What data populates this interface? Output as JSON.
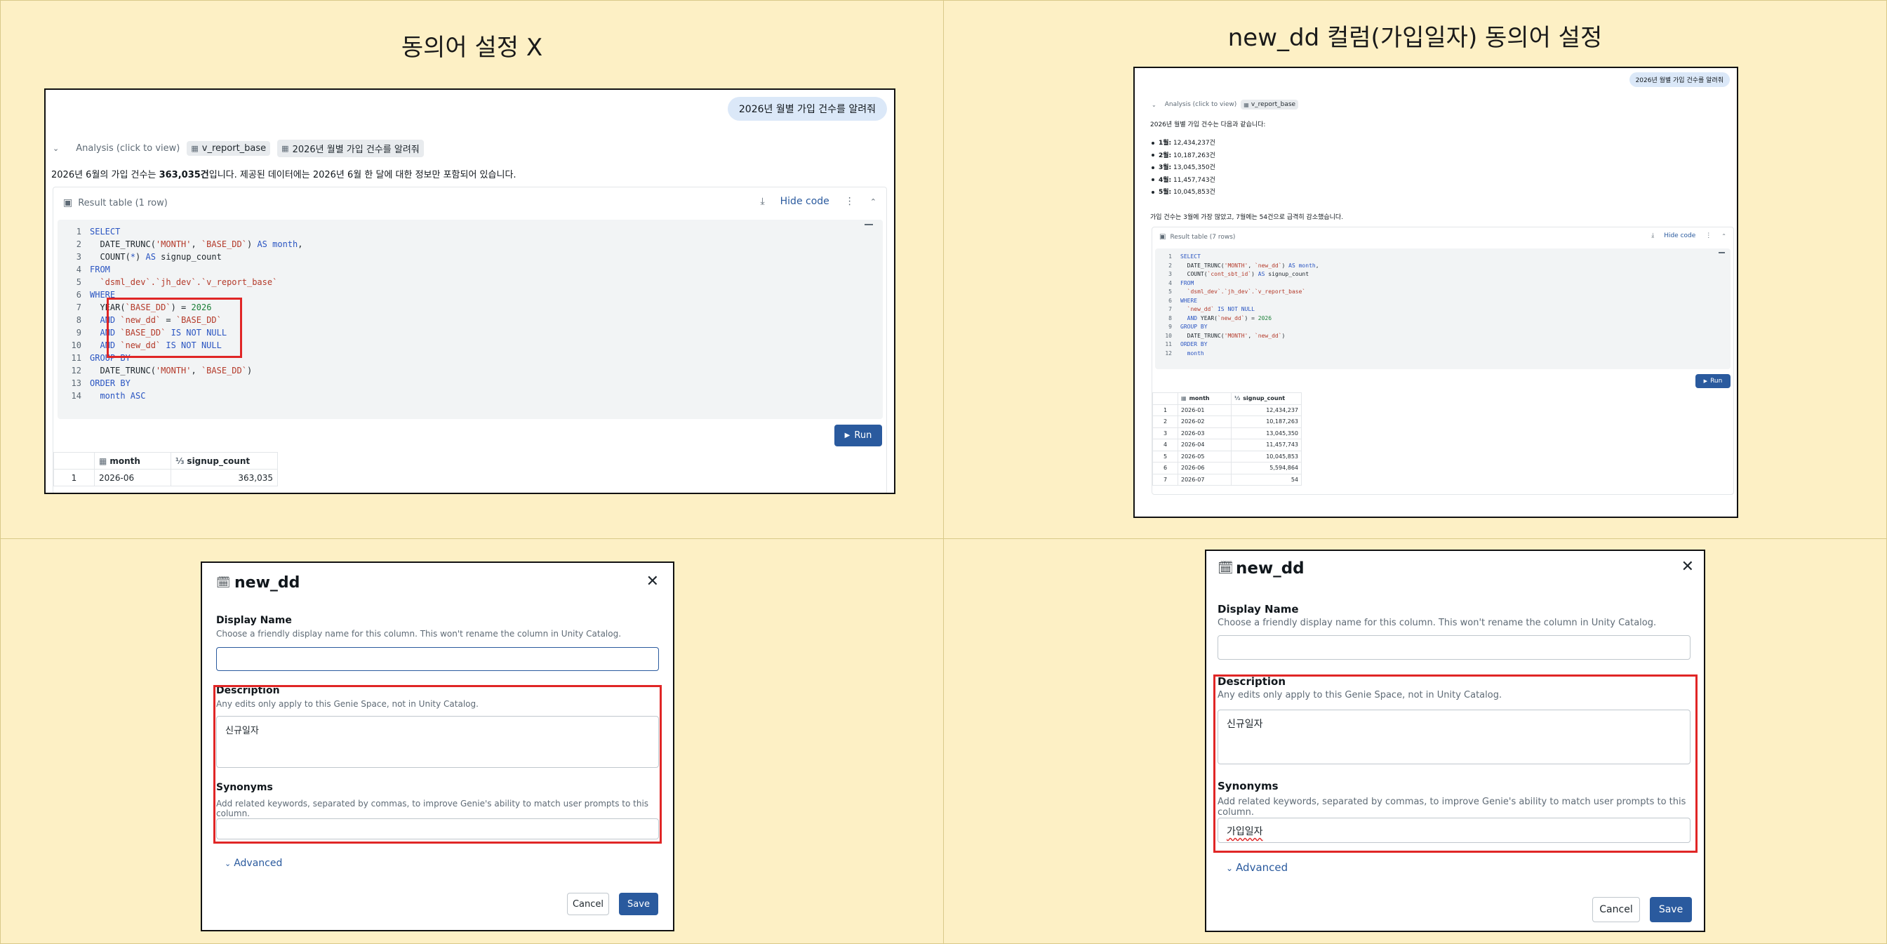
{
  "quadrants": {
    "top_left_title": "동의어 설정 X",
    "top_right_title": "new_dd 컬럼(가입일자) 동의어 설정"
  },
  "left_chat": {
    "user_message": "2026년 월별 가입 건수를 알려줘",
    "analysis_label": "Analysis (click to view)",
    "chip_table": "v_report_base",
    "chip_query": "2026년 월별 가입 건수를 알려줘",
    "answer_pre": "2026년 6월의 가입 건수는 ",
    "answer_bold": "363,035건",
    "answer_post": "입니다. 제공된 데이터에는 2026년 6월 한 달에 대한 정보만 포함되어 있습니다.",
    "result_title": "Result table (1 row)",
    "hide_code": "Hide code",
    "run_label": "Run",
    "code_lines": [
      [
        "1",
        [
          [
            "kw",
            "SELECT"
          ]
        ]
      ],
      [
        "2",
        [
          [
            "plain",
            "  DATE_TRUNC("
          ],
          [
            "str",
            "'MONTH'"
          ],
          [
            "plain",
            ", "
          ],
          [
            "str",
            "`BASE_DD`"
          ],
          [
            "plain",
            ") "
          ],
          [
            "kw",
            "AS"
          ],
          [
            "kw",
            " month"
          ],
          [
            "plain",
            ","
          ]
        ]
      ],
      [
        "3",
        [
          [
            "plain",
            "  COUNT("
          ],
          [
            "kw",
            "*"
          ],
          [
            "plain",
            ") "
          ],
          [
            "kw",
            "AS"
          ],
          [
            "plain",
            " signup_count"
          ]
        ]
      ],
      [
        "4",
        [
          [
            "kw",
            "FROM"
          ]
        ]
      ],
      [
        "5",
        [
          [
            "str",
            "  `dsml_dev`.`jh_dev`.`v_report_base`"
          ]
        ]
      ],
      [
        "6",
        [
          [
            "kw",
            "WHERE"
          ]
        ]
      ],
      [
        "7",
        [
          [
            "plain",
            "  YEAR("
          ],
          [
            "str",
            "`BASE_DD`"
          ],
          [
            "plain",
            ") = "
          ],
          [
            "num",
            "2026"
          ]
        ]
      ],
      [
        "8",
        [
          [
            "kw",
            "  AND "
          ],
          [
            "str",
            "`new_dd`"
          ],
          [
            "plain",
            " = "
          ],
          [
            "str",
            "`BASE_DD`"
          ]
        ]
      ],
      [
        "9",
        [
          [
            "kw",
            "  AND "
          ],
          [
            "str",
            "`BASE_DD`"
          ],
          [
            "kw",
            " IS NOT NULL"
          ]
        ]
      ],
      [
        "10",
        [
          [
            "kw",
            "  AND "
          ],
          [
            "str",
            "`new_dd`"
          ],
          [
            "kw",
            " IS NOT NULL"
          ]
        ]
      ],
      [
        "11",
        [
          [
            "kw",
            "GROUP BY"
          ]
        ]
      ],
      [
        "12",
        [
          [
            "plain",
            "  DATE_TRUNC("
          ],
          [
            "str",
            "'MONTH'"
          ],
          [
            "plain",
            ", "
          ],
          [
            "str",
            "`BASE_DD`"
          ],
          [
            "plain",
            ")"
          ]
        ]
      ],
      [
        "13",
        [
          [
            "kw",
            "ORDER BY"
          ]
        ]
      ],
      [
        "14",
        [
          [
            "kw",
            "  month ASC"
          ]
        ]
      ]
    ],
    "table_headers": [
      "month",
      "signup_count"
    ],
    "table_rows": [
      [
        "1",
        "2026-06",
        "363,035"
      ]
    ]
  },
  "right_chat": {
    "user_message": "2026년 월별 가입 건수를 알려줘",
    "analysis_label": "Analysis (click to view)",
    "chip_table": "v_report_base",
    "answer_intro": "2026년 월별 가입 건수는 다음과 같습니다:",
    "bullets": [
      {
        "month": "1월:",
        "value": "12,434,237건"
      },
      {
        "month": "2월:",
        "value": "10,187,263건"
      },
      {
        "month": "3월:",
        "value": "13,045,350건"
      },
      {
        "month": "4월:",
        "value": "11,457,743건"
      },
      {
        "month": "5월:",
        "value": "10,045,853건"
      }
    ],
    "answer_tail": "가입 건수는 3월에 가장 많았고, 7월에는 54건으로 급격히 감소했습니다.",
    "result_title": "Result table (7 rows)",
    "hide_code": "Hide code",
    "run_label": "Run",
    "code_lines": [
      [
        "1",
        [
          [
            "kw",
            "SELECT"
          ]
        ]
      ],
      [
        "2",
        [
          [
            "plain",
            "  DATE_TRUNC("
          ],
          [
            "str",
            "'MONTH'"
          ],
          [
            "plain",
            ", "
          ],
          [
            "str",
            "`new_dd`"
          ],
          [
            "plain",
            ") "
          ],
          [
            "kw",
            "AS"
          ],
          [
            "kw",
            " month"
          ],
          [
            "plain",
            ","
          ]
        ]
      ],
      [
        "3",
        [
          [
            "plain",
            "  COUNT("
          ],
          [
            "str",
            "`cont_sbt_id`"
          ],
          [
            "plain",
            ") "
          ],
          [
            "kw",
            "AS"
          ],
          [
            "plain",
            " signup_count"
          ]
        ]
      ],
      [
        "4",
        [
          [
            "kw",
            "FROM"
          ]
        ]
      ],
      [
        "5",
        [
          [
            "str",
            "  `dsml_dev`.`jh_dev`.`v_report_base`"
          ]
        ]
      ],
      [
        "6",
        [
          [
            "kw",
            "WHERE"
          ]
        ]
      ],
      [
        "7",
        [
          [
            "str",
            "  `new_dd`"
          ],
          [
            "kw",
            " IS NOT NULL"
          ]
        ]
      ],
      [
        "8",
        [
          [
            "kw",
            "  AND "
          ],
          [
            "plain",
            "YEAR("
          ],
          [
            "str",
            "`new_dd`"
          ],
          [
            "plain",
            ") = "
          ],
          [
            "num",
            "2026"
          ]
        ]
      ],
      [
        "9",
        [
          [
            "kw",
            "GROUP BY"
          ]
        ]
      ],
      [
        "10",
        [
          [
            "plain",
            "  DATE_TRUNC("
          ],
          [
            "str",
            "'MONTH'"
          ],
          [
            "plain",
            ", "
          ],
          [
            "str",
            "`new_dd`"
          ],
          [
            "plain",
            ")"
          ]
        ]
      ],
      [
        "11",
        [
          [
            "kw",
            "ORDER BY"
          ]
        ]
      ],
      [
        "12",
        [
          [
            "kw",
            "  month"
          ]
        ]
      ]
    ],
    "table_headers": [
      "month",
      "signup_count"
    ],
    "table_rows": [
      [
        "1",
        "2026-01",
        "12,434,237"
      ],
      [
        "2",
        "2026-02",
        "10,187,263"
      ],
      [
        "3",
        "2026-03",
        "13,045,350"
      ],
      [
        "4",
        "2026-04",
        "11,457,743"
      ],
      [
        "5",
        "2026-05",
        "10,045,853"
      ],
      [
        "6",
        "2026-06",
        "5,594,864"
      ],
      [
        "7",
        "2026-07",
        "54"
      ]
    ]
  },
  "left_modal": {
    "title": "new_dd",
    "display_name_label": "Display Name",
    "display_name_hint": "Choose a friendly display name for this column. This won't rename the column in Unity Catalog.",
    "display_name_value": "",
    "description_label": "Description",
    "description_hint": "Any edits only apply to this Genie Space, not in Unity Catalog.",
    "description_value": "신규일자",
    "synonyms_label": "Synonyms",
    "synonyms_hint": "Add related keywords, separated by commas, to improve Genie's ability to match user prompts to this column.",
    "synonyms_value": "",
    "advanced_label": "Advanced",
    "cancel_label": "Cancel",
    "save_label": "Save"
  },
  "right_modal": {
    "title": "new_dd",
    "display_name_label": "Display Name",
    "display_name_hint": "Choose a friendly display name for this column. This won't rename the column in Unity Catalog.",
    "display_name_value": "",
    "description_label": "Description",
    "description_hint": "Any edits only apply to this Genie Space, not in Unity Catalog.",
    "description_value": "신규일자",
    "synonyms_label": "Synonyms",
    "synonyms_hint": "Add related keywords, separated by commas, to improve Genie's ability to match user prompts to this column.",
    "synonyms_value": "가입일자",
    "advanced_label": "Advanced",
    "cancel_label": "Cancel",
    "save_label": "Save"
  },
  "colors": {
    "background": "#fdf0c5",
    "accent_blue": "#2a5a9e",
    "highlight_red": "#e02626",
    "bubble_blue": "#dbe8f8"
  }
}
